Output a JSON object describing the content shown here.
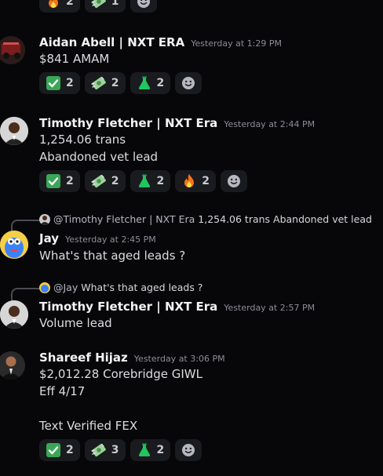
{
  "top_reactions": [
    {
      "icon": "fire",
      "count": "2"
    },
    {
      "icon": "money",
      "count": "1"
    }
  ],
  "messages": [
    {
      "name": "Aidan Abell | NXT ERA",
      "time": "Yesterday at 1:29 PM",
      "lines": [
        "$841 AMAM"
      ],
      "reactions": [
        {
          "icon": "check",
          "count": "2"
        },
        {
          "icon": "money",
          "count": "2"
        },
        {
          "icon": "flask",
          "count": "2"
        }
      ]
    },
    {
      "name": "Timothy Fletcher | NXT Era",
      "time": "Yesterday at 2:44 PM",
      "lines": [
        "1,254.06 trans",
        "Abandoned vet lead"
      ],
      "reactions": [
        {
          "icon": "check",
          "count": "2"
        },
        {
          "icon": "money",
          "count": "2"
        },
        {
          "icon": "flask",
          "count": "2"
        },
        {
          "icon": "fire",
          "count": "2"
        }
      ]
    },
    {
      "reply_to": "@Timothy Fletcher | NXT Era",
      "reply_text": "1,254.06 trans  Abandoned vet lead",
      "name": "Jay",
      "time": "Yesterday at 2:45 PM",
      "lines": [
        "What's that aged leads ?"
      ]
    },
    {
      "reply_to": "@Jay",
      "reply_text": "What's that aged leads ?",
      "name": "Timothy Fletcher | NXT Era",
      "time": "Yesterday at 2:57 PM",
      "lines": [
        "Volume lead"
      ]
    },
    {
      "name": "Shareef Hijaz",
      "time": "Yesterday at 3:06 PM",
      "lines": [
        "$2,012.28 Corebridge GIWL",
        "Eff 4/17",
        "",
        "Text Verified FEX"
      ],
      "reactions": [
        {
          "icon": "check",
          "count": "2"
        },
        {
          "icon": "money",
          "count": "3"
        },
        {
          "icon": "flask",
          "count": "2"
        }
      ]
    }
  ],
  "colors": {
    "background": "#070709",
    "pill": "#1a1b1f",
    "check": "#3aa757",
    "flask": "#22c55e",
    "fire": "#f97316"
  }
}
